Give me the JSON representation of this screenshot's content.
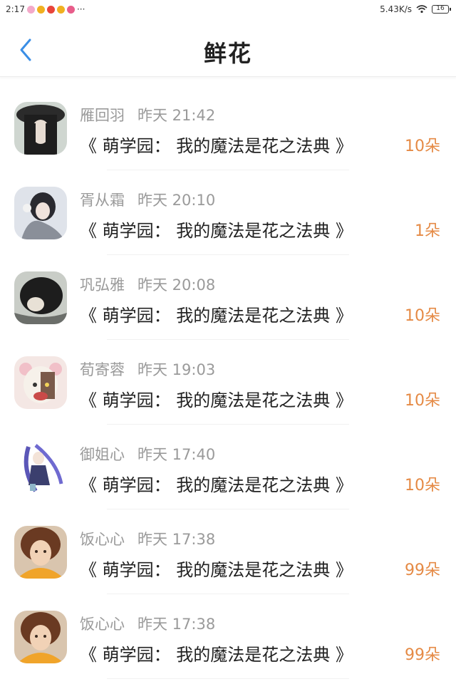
{
  "status_bar": {
    "time": "2:17",
    "more": "···",
    "network_speed": "5.43K/s",
    "battery": "16"
  },
  "header": {
    "title": "鲜花"
  },
  "colors": {
    "accent_orange": "#e58a45",
    "back_blue": "#3a8ee6"
  },
  "items": [
    {
      "name": "雁回羽",
      "time": "昨天 21:42",
      "book": "《 萌学园： 我的魔法是花之法典 》",
      "count": "10朵",
      "avatar": "avatar-1"
    },
    {
      "name": "胥从霜",
      "time": "昨天 20:10",
      "book": "《 萌学园： 我的魔法是花之法典 》",
      "count": "1朵",
      "avatar": "avatar-2"
    },
    {
      "name": "巩弘雅",
      "time": "昨天 20:08",
      "book": "《 萌学园： 我的魔法是花之法典 》",
      "count": "10朵",
      "avatar": "avatar-3"
    },
    {
      "name": "荀寄蓉",
      "time": "昨天 19:03",
      "book": "《 萌学园： 我的魔法是花之法典 》",
      "count": "10朵",
      "avatar": "avatar-4"
    },
    {
      "name": "御姐心",
      "time": "昨天 17:40",
      "book": "《 萌学园： 我的魔法是花之法典 》",
      "count": "10朵",
      "avatar": "avatar-5"
    },
    {
      "name": "饭心心",
      "time": "昨天 17:38",
      "book": "《 萌学园： 我的魔法是花之法典 》",
      "count": "99朵",
      "avatar": "avatar-6"
    },
    {
      "name": "饭心心",
      "time": "昨天 17:38",
      "book": "《 萌学园： 我的魔法是花之法典 》",
      "count": "99朵",
      "avatar": "avatar-7"
    }
  ]
}
